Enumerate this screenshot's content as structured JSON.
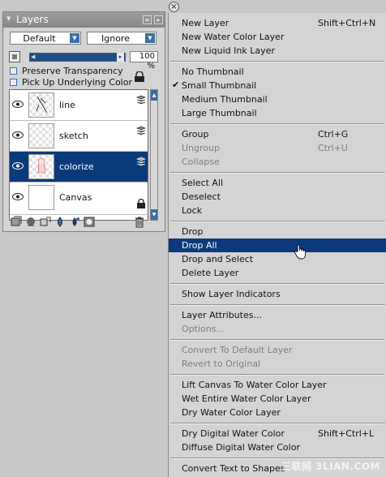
{
  "palette": {
    "title": "Layers",
    "composite_method": "Default",
    "composite_depth": "Ignore",
    "opacity": "100 %",
    "preserve_transparency": "Preserve Transparency",
    "pick_up_underlying": "Pick Up Underlying Color",
    "layers": [
      {
        "name": "line",
        "selected": false
      },
      {
        "name": "sketch",
        "selected": false
      },
      {
        "name": "colorize",
        "selected": true
      },
      {
        "name": "Canvas",
        "selected": false
      }
    ]
  },
  "menu": {
    "items": [
      {
        "label": "New Layer",
        "shortcut": "Shift+Ctrl+N"
      },
      {
        "label": "New Water Color Layer",
        "shortcut": ""
      },
      {
        "label": "New Liquid Ink Layer",
        "shortcut": ""
      },
      {
        "label": "No Thumbnail",
        "shortcut": ""
      },
      {
        "label": "Small Thumbnail",
        "shortcut": "",
        "checked": true
      },
      {
        "label": "Medium Thumbnail",
        "shortcut": ""
      },
      {
        "label": "Large Thumbnail",
        "shortcut": ""
      },
      {
        "label": "Group",
        "shortcut": "Ctrl+G"
      },
      {
        "label": "Ungroup",
        "shortcut": "Ctrl+U",
        "disabled": true
      },
      {
        "label": "Collapse",
        "shortcut": "",
        "disabled": true
      },
      {
        "label": "Select All",
        "shortcut": ""
      },
      {
        "label": "Deselect",
        "shortcut": ""
      },
      {
        "label": "Lock",
        "shortcut": ""
      },
      {
        "label": "Drop",
        "shortcut": ""
      },
      {
        "label": "Drop All",
        "shortcut": "",
        "highlighted": true
      },
      {
        "label": "Drop and Select",
        "shortcut": ""
      },
      {
        "label": "Delete Layer",
        "shortcut": ""
      },
      {
        "label": "Show Layer Indicators",
        "shortcut": ""
      },
      {
        "label": "Layer Attributes...",
        "shortcut": ""
      },
      {
        "label": "Options...",
        "shortcut": "",
        "disabled": true
      },
      {
        "label": "Convert To Default Layer",
        "shortcut": "",
        "disabled": true
      },
      {
        "label": "Revert to Original",
        "shortcut": "",
        "disabled": true
      },
      {
        "label": "Lift Canvas To Water Color Layer",
        "shortcut": ""
      },
      {
        "label": "Wet Entire Water Color Layer",
        "shortcut": ""
      },
      {
        "label": "Dry Water Color Layer",
        "shortcut": ""
      },
      {
        "label": "Dry Digital Water Color",
        "shortcut": "Shift+Ctrl+L"
      },
      {
        "label": "Diffuse Digital Water Color",
        "shortcut": ""
      },
      {
        "label": "Convert Text to Shapes",
        "shortcut": ""
      }
    ]
  },
  "watermark": "三联网 3LIAN.COM",
  "colors": {
    "selection": "#0b3a7a",
    "accent": "#3a6ea5"
  }
}
